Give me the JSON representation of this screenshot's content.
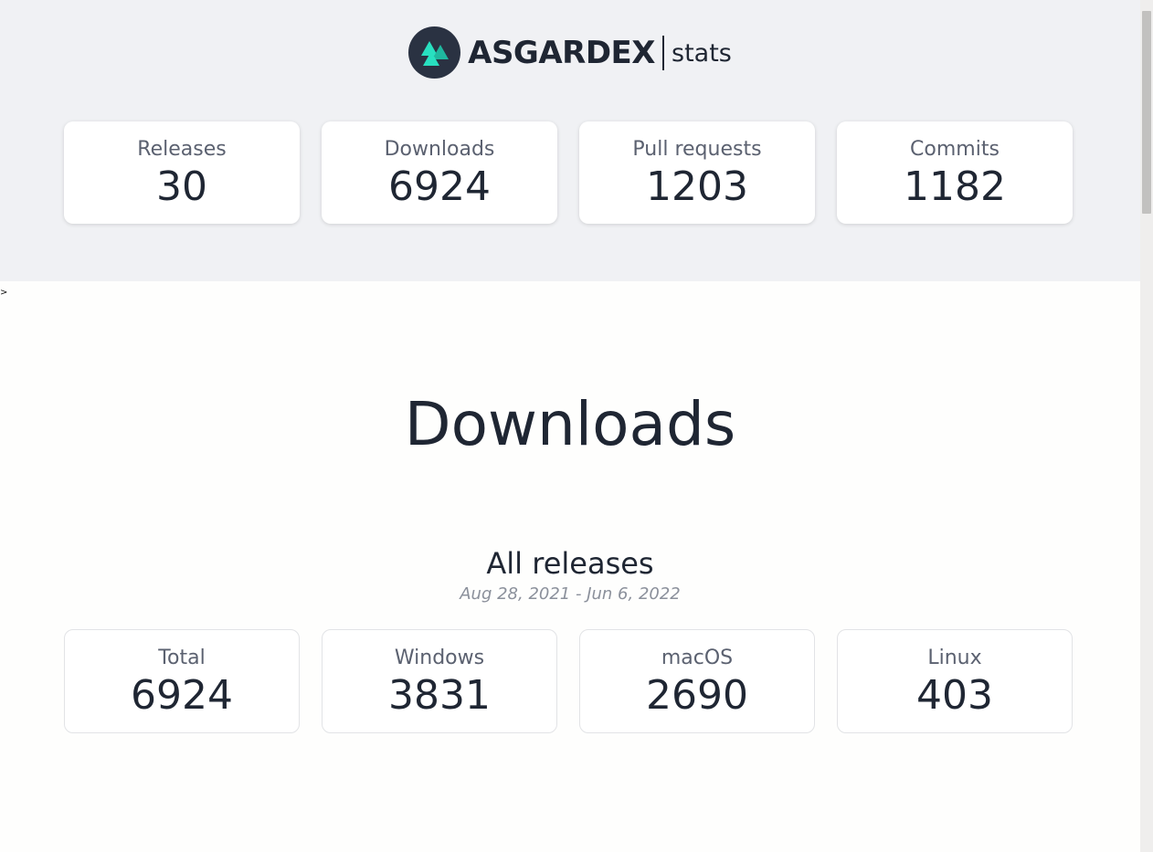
{
  "brand": {
    "name": "ASGARDEX",
    "suffix": "stats",
    "accent": "#28e0c0",
    "mark_bg": "#2a3242"
  },
  "summary": [
    {
      "label": "Releases",
      "value": "30"
    },
    {
      "label": "Downloads",
      "value": "6924"
    },
    {
      "label": "Pull requests",
      "value": "1203"
    },
    {
      "label": "Commits",
      "value": "1182"
    }
  ],
  "cursor_glyph": ">",
  "downloads": {
    "title": "Downloads",
    "subtitle": "All releases",
    "date_range": "Aug 28, 2021 - Jun 6, 2022",
    "stats": [
      {
        "label": "Total",
        "value": "6924"
      },
      {
        "label": "Windows",
        "value": "3831"
      },
      {
        "label": "macOS",
        "value": "2690"
      },
      {
        "label": "Linux",
        "value": "403"
      }
    ]
  }
}
